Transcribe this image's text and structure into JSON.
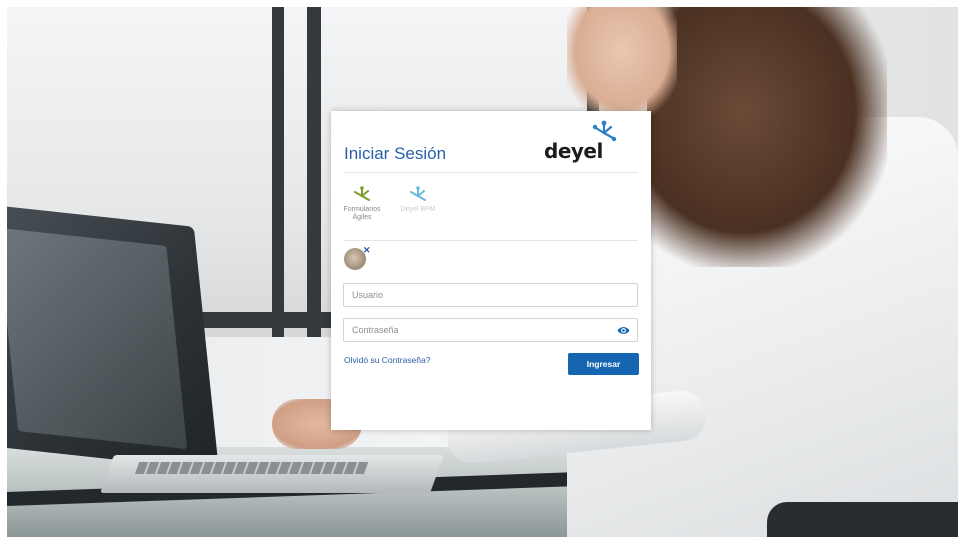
{
  "login": {
    "title": "Iniciar Sesión",
    "logo_text": "deyel",
    "apps": [
      {
        "label_line1": "Formularios",
        "label_line2": "Ágiles",
        "icon": "green-frog-icon",
        "color": "#7a9c2a"
      },
      {
        "label_line1": "Deyel BPM",
        "label_line2": "",
        "icon": "blue-frog-icon",
        "color": "#6fb6e0"
      }
    ],
    "username_placeholder": "Usuario",
    "password_placeholder": "Contraseña",
    "forgot_label": "Olvidó su Contraseña?",
    "submit_label": "Ingresar"
  },
  "colors": {
    "accent": "#2b5ea8",
    "button": "#1565b0",
    "logo_blue": "#2f7fc4"
  }
}
